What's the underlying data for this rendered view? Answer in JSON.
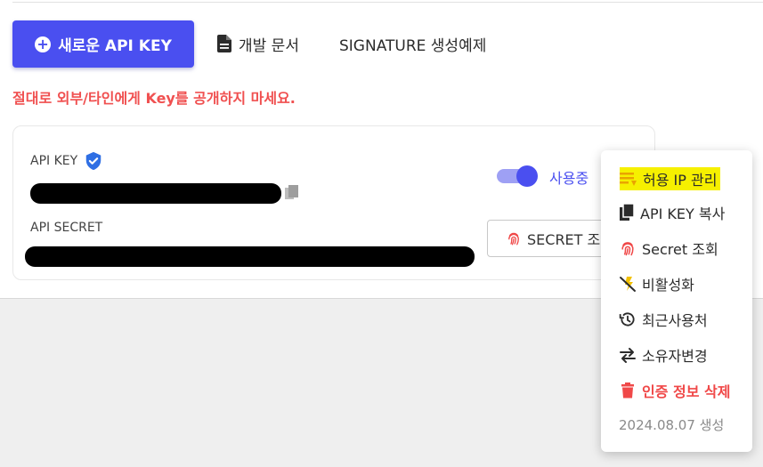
{
  "toolbar": {
    "new_key_label": "새로운 API KEY",
    "docs_label": "개발 문서",
    "signature_label": "SIGNATURE 생성예제"
  },
  "warning": "절대로 외부/타인에게 Key를 공개하지 마세요.",
  "card": {
    "api_key_label": "API KEY",
    "api_secret_label": "API SECRET",
    "status_label": "사용중",
    "status_enabled": true,
    "secret_button_label": "SECRET 조회"
  },
  "menu": {
    "items": [
      {
        "label": "허용 IP 관리",
        "icon": "ip-list-icon"
      },
      {
        "label": "API KEY 복사",
        "icon": "copy-icon"
      },
      {
        "label": "Secret 조회",
        "icon": "fingerprint-icon"
      },
      {
        "label": "비활성화",
        "icon": "disable-icon"
      },
      {
        "label": "최근사용처",
        "icon": "history-icon"
      },
      {
        "label": "소유자변경",
        "icon": "swap-icon"
      },
      {
        "label": "인증 정보 삭제",
        "icon": "trash-icon"
      }
    ],
    "created": "2024.08.07 생성"
  },
  "colors": {
    "accent": "#4a4ff0",
    "warning": "#f05050",
    "highlight": "#f6f000"
  }
}
